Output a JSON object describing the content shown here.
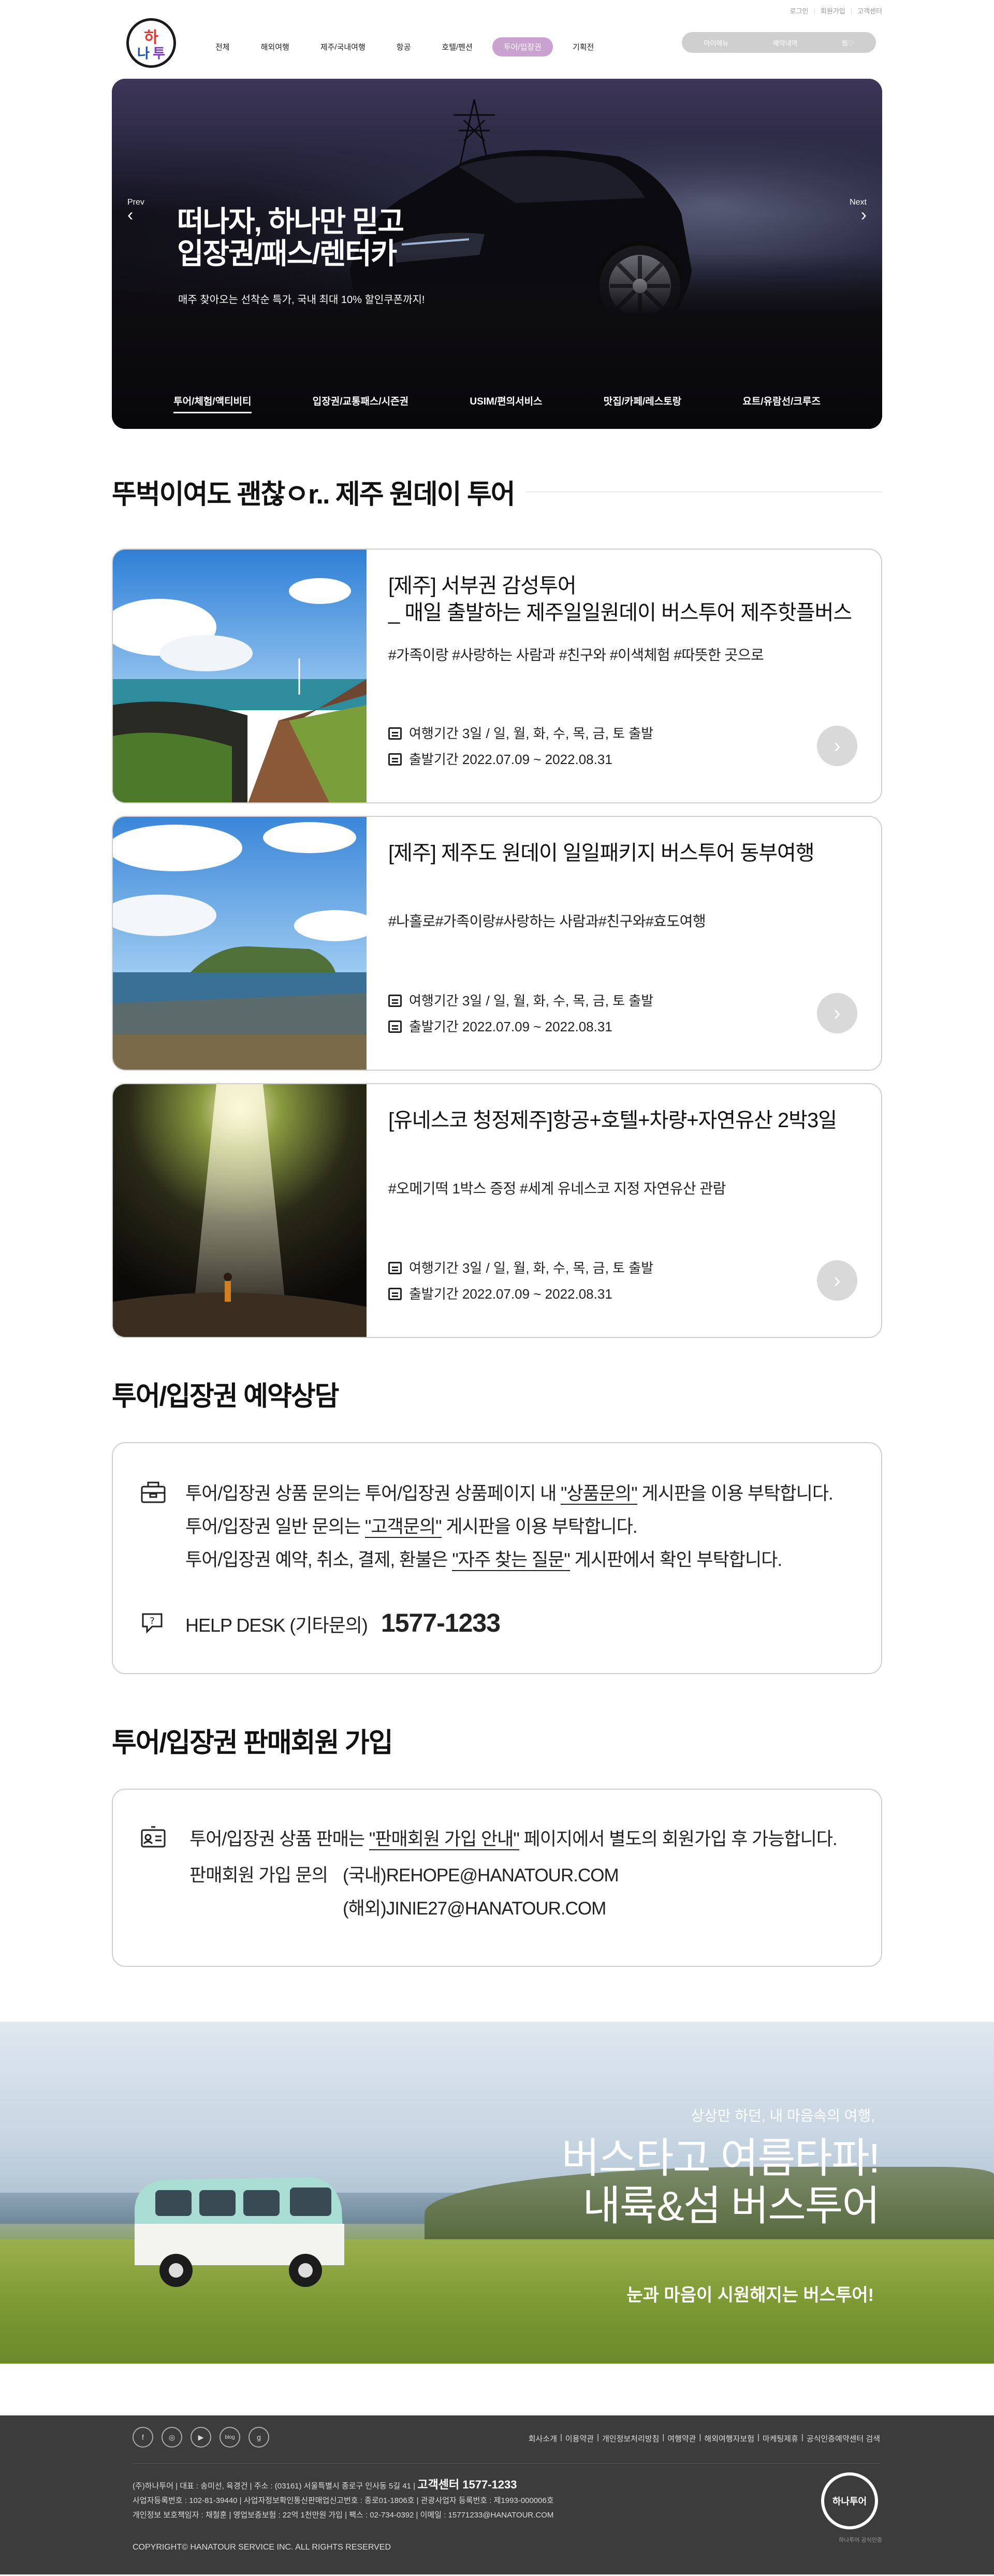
{
  "util_links": [
    "로그인",
    "회원가입",
    "고객센터"
  ],
  "logo_text": "하나투어",
  "menu": [
    {
      "label": "전체",
      "active": false
    },
    {
      "label": "해외여행",
      "active": false
    },
    {
      "label": "제주/국내여행",
      "active": false
    },
    {
      "label": "항공",
      "active": false
    },
    {
      "label": "호텔/펜션",
      "active": false
    },
    {
      "label": "투어/입장권",
      "active": true
    },
    {
      "label": "기획전",
      "active": false
    }
  ],
  "top_pill": [
    "마이메뉴",
    "예약내역",
    "찜♡"
  ],
  "hero": {
    "prev": "Prev",
    "next": "Next",
    "title": "떠나자, 하나만 믿고\n입장권/패스/렌터카",
    "subtitle": "매주 찾아오는 선착순 특가, 국내 최대 10% 할인쿠폰까지!",
    "categories": [
      "투어/체험/액티비티",
      "입장권/교통패스/시즌권",
      "USIM/편의서비스",
      "맛집/카페/레스토랑",
      "요트/유람선/크루즈"
    ]
  },
  "tour_section_title": "뚜벅이여도 괜찮ㅇr.. 제주 원데이 투어",
  "tours": [
    {
      "title": "[제주] 서부권 감성투어\n_ 매일 출발하는 제주일일원데이 버스투어 제주핫플버스",
      "tags": "#가족이랑 #사랑하는 사람과 #친구와 #이색체험 #따뜻한 곳으로",
      "period": "여행기간 3일 / 일, 월, 화, 수, 목, 금, 토 출발",
      "depart": "출발기간 2022.07.09 ~ 2022.08.31"
    },
    {
      "title": "[제주] 제주도 원데이 일일패키지 버스투어 동부여행",
      "tags": "#나홀로#가족이랑#사랑하는 사람과#친구와#효도여행",
      "period": "여행기간 3일 / 일, 월, 화, 수, 목, 금, 토 출발",
      "depart": "출발기간 2022.07.09 ~ 2022.08.31"
    },
    {
      "title": "[유네스코 청정제주]항공+호텔+차량+자연유산 2박3일",
      "tags": "#오메기떡 1박스 증정 #세계 유네스코 지정 자연유산 관람",
      "period": "여행기간 3일 / 일, 월, 화, 수, 목, 금, 토 출발",
      "depart": "출발기간 2022.07.09 ~ 2022.08.31"
    }
  ],
  "consult": {
    "title": "투어/입장권 예약상담",
    "line1_a": "투어/입장권 상품 문의는 투어/입장권 상품페이지 내 ",
    "line1_u": "\"상품문의\"",
    "line1_b": " 게시판을 이용 부탁합니다.",
    "line2_a": "투어/입장권 일반 문의는 ",
    "line2_u": "\"고객문의\"",
    "line2_b": " 게시판을 이용 부탁합니다.",
    "line3_a": "투어/입장권 예약, 취소, 결제, 환불은 ",
    "line3_u": "\"자주 찾는 질문\"",
    "line3_b": " 게시판에서 확인 부탁합니다.",
    "help_label": "HELP DESK (기타문의)",
    "help_number": "1577-1233"
  },
  "seller": {
    "title": "투어/입장권 판매회원 가입",
    "line1_a": "투어/입장권 상품 판매는 ",
    "line1_u": "\"판매회원 가입 안내\"",
    "line1_b": " 페이지에서 별도의 회원가입 후 가능합니다.",
    "contact_label": "판매회원 가입 문의",
    "domestic": "(국내)REHOPE@HANATOUR.COM",
    "overseas": "(해외)JINIE27@HANATOUR.COM"
  },
  "banner": {
    "small": "상상만 하던, 내 마음속의 여행,",
    "big": "버스타고 여름타파!\n내륙&섬 버스투어",
    "bottom": "눈과 마음이 시원해지는 버스투어!"
  },
  "footer": {
    "sns": [
      "f",
      "◎",
      "▶",
      "blog",
      "g"
    ],
    "links": [
      "회사소개",
      "이용약관",
      "개인정보처리방침",
      "여행약관",
      "해외여행자보험",
      "마케팅제휴",
      "공식인증예약센터 검색"
    ],
    "info1": "(주)하나투어 | 대표 : 송미선, 육경건 | 주소 : (03161) 서울특별시 종로구 인사동 5길 41 |",
    "cs": "고객센터 1577-1233",
    "info2": "사업자등록번호 : 102-81-39440 | 사업자정보확인통신판매업신고번호 : 종로01-1806호 | 관광사업자 등록번호 : 제1993-000006호",
    "info3": "개인정보 보호책임자 : 채철훈 | 영업보증보험 : 22억 1천만원 가입 | 팩스 : 02-734-0392 | 이메일 : 15771233@HANATOUR.COM",
    "copyright": "COPYRIGHT© HANATOUR SERVICE INC. ALL RIGHTS RESERVED",
    "logo": "하나투어",
    "logo_caption": "하나투어 공식인증"
  }
}
